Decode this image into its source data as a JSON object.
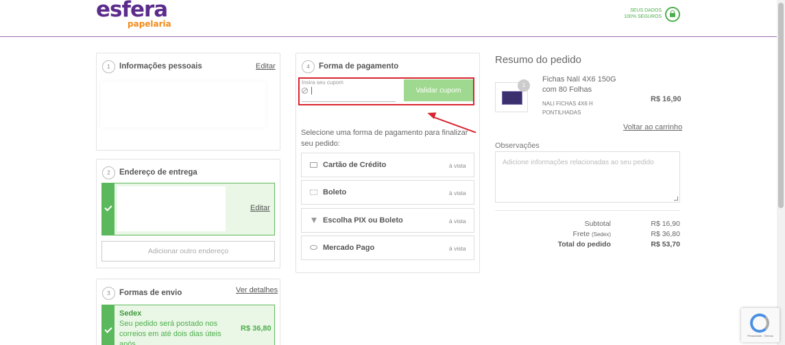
{
  "header": {
    "logo_main": "esfera",
    "logo_sub": "papelaria",
    "secure_line1": "SEUS DADOS",
    "secure_line2": "100% SEGUROS"
  },
  "personal": {
    "step": "1",
    "title": "Informações pessoais",
    "edit_label": "Editar"
  },
  "address": {
    "step": "2",
    "title": "Endereço de entrega",
    "edit_label": "Editar",
    "add_label": "Adicionar outro endereço"
  },
  "shipping": {
    "step": "3",
    "title": "Formas de envio",
    "details_label": "Ver detalhes",
    "option_name": "Sedex",
    "option_desc": "Seu pedido será postado nos correios em até dois dias úteis após",
    "option_price": "R$ 36,80"
  },
  "payment": {
    "step": "4",
    "title": "Forma de pagamento",
    "coupon_placeholder": "Insira seu cupom",
    "coupon_button": "Validar cupom",
    "instruction": "Selecione uma forma de pagamento para finalizar seu pedido:",
    "options": [
      {
        "label": "Cartão de Crédito",
        "note": "à vista",
        "icon": "credit-card-icon"
      },
      {
        "label": "Boleto",
        "note": "à vista",
        "icon": "barcode-icon"
      },
      {
        "label": "Escolha PIX ou Boleto",
        "note": "à vista",
        "icon": "pix-icon"
      },
      {
        "label": "Mercado Pago",
        "note": "à vista",
        "icon": "mercado-pago-icon"
      }
    ]
  },
  "summary": {
    "title": "Resumo do pedido",
    "product": {
      "qty": "1",
      "name": "Fichas Nalí 4X6 150G com 80 Folhas",
      "sub": "NALI FICHAS 4X6 H PONTILHADAS",
      "price": "R$ 16,90"
    },
    "back_link": "Voltar ao carrinho",
    "obs_label": "Observações",
    "obs_placeholder": "Adicione informações relacionadas ao seu pedido",
    "subtotal_label": "Subtotal",
    "subtotal_value": "R$ 16,90",
    "frete_label": "Frete",
    "frete_note": "(Sedex)",
    "frete_value": "R$ 36,80",
    "total_label": "Total do pedido",
    "total_value": "R$ 53,70"
  },
  "recaptcha": {
    "text": "Privacidade - Termos"
  },
  "colors": {
    "brand_purple": "#5b2c8c",
    "brand_orange": "#f28c1b",
    "success_green": "#5cb85c",
    "highlight_red": "#d9232d"
  }
}
